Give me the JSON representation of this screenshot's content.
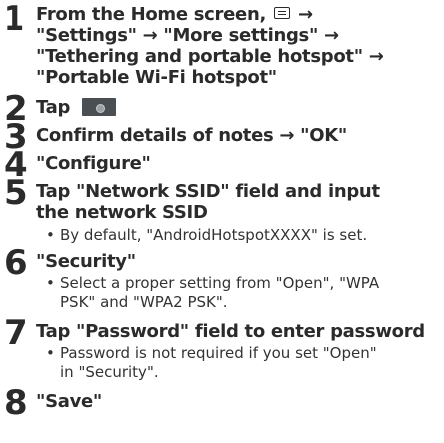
{
  "steps": [
    {
      "number": "1",
      "lines": [
        "From the Home screen,",
        "→",
        "\"Settings\" → \"More settings\" →",
        "\"Tethering and portable hotspot\" →",
        "\"Portable Wi-Fi hotspot\""
      ],
      "icon": "menu-key-icon"
    },
    {
      "number": "2",
      "text": "Tap",
      "icon": "hotspot-toggle-icon"
    },
    {
      "number": "3",
      "text": "Confirm details of notes → \"OK\""
    },
    {
      "number": "4",
      "text": "\"Configure\""
    },
    {
      "number": "5",
      "lines": [
        "Tap \"Network SSID\" field and input",
        "the network SSID"
      ],
      "notes": [
        "By default, \"AndroidHotspotXXXX\" is set."
      ]
    },
    {
      "number": "6",
      "text": "\"Security\"",
      "notes": [
        "Select a proper setting from \"Open\", \"WPA",
        "PSK\" and \"WPA2 PSK\"."
      ]
    },
    {
      "number": "7",
      "text": "Tap \"Password\" field to enter password",
      "notes": [
        "Password is not required if you set \"Open\"",
        "in \"Security\"."
      ]
    },
    {
      "number": "8",
      "text": "\"Save\""
    }
  ],
  "bullet": "•"
}
